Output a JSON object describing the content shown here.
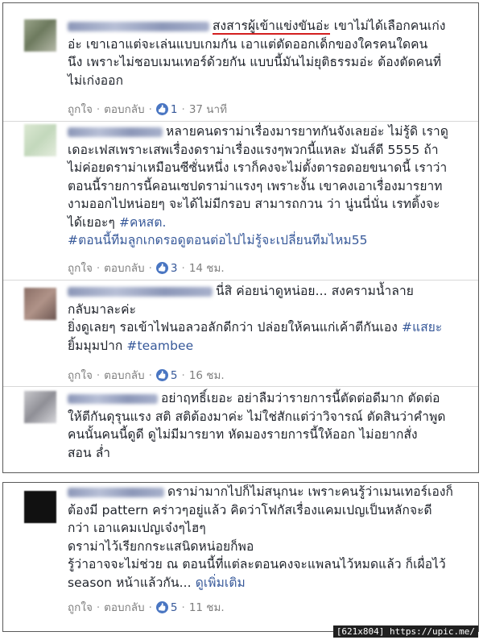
{
  "comments": [
    {
      "lines": [
        "",
        "อ่ะ เขาเอาแต่จะเล่นแบบเกมกัน เอาแต่ตัดออกเด็กของใครคนใดคน",
        "นึง เพราะไม่ชอบเมนเทอร์ด้วยกัน แบบนี้มันไม่ยุติธรรมอ่ะ ต้องตัดคนที่",
        "ไม่เก่งออก"
      ],
      "first_line_highlight": "สงสารผู้เข้าแข่งขันอ่ะ",
      "first_line_rest": " เขาไม่ได้เลือกคนเก่ง",
      "like_label": "ถูกใจ",
      "reply_label": "ตอบกลับ",
      "likes": "1",
      "time": "37 นาที"
    },
    {
      "lines": [
        "หลายคนดราม่าเรื่องมารยาทกันจังเลยอ่ะ ไม่รู้ดิ เราดู",
        "เดอะเฟสเพราะเสพเรื่องดราม่าเรื่องแรงๆพวกนี้แหละ มันส์ดี 5555 ถ้า",
        "ไม่ค่อยดราม่าเหมือนซีซั่นหนึ่ง เราก็คงจะไม่ตั้งตารอดอยขนาดนี้ เราว่า",
        "ตอนนี้รายการนี้คอนเซปดราม่าแรงๆ เพราะงั้น เขาคงเอาเรื่องมารยาท",
        "งามออกไปหน่อยๆ จะได้ไม่มีกรอบ สามารถกวน ว่า นู่นนี่นั่น เรทติ้งจะ",
        "ได้เยอะๆ"
      ],
      "hashtag_inline": "#คหสต.",
      "hashtag_line": "#ตอนนี้ทีมลูกเกดรอดูตอนต่อไปไม่รู้จะเปลี่ยนทีมไหม55",
      "like_label": "ถูกใจ",
      "reply_label": "ตอบกลับ",
      "likes": "3",
      "time": "14 ชม."
    },
    {
      "lines": [
        "นี่สิ ค่อยน่าดูหน่อย... สงครามน้ำลาย",
        "กลับมาละค่ะ",
        "ยิ่งดูเลยๆ รอเข้าไฟนอลวอลักดีกว่า ปล่อยให้คนแก่เค้าตีกันเอง",
        "ยิ้มมุมปาก"
      ],
      "hashtag_a": "#แสยะ",
      "hashtag_b": "#teambee",
      "like_label": "ถูกใจ",
      "reply_label": "ตอบกลับ",
      "likes": "5",
      "time": "16 ชม."
    },
    {
      "lines": [
        "อย่าฤทธิ์เยอะ อย่าลืมว่ารายการนี้ตัดต่อดีมาก ตัดต่อ",
        "ให้ตีกันดุรุนแรง สติ สติต้องมาค่ะ ไม่ใช่สักแต่ว่าวิจารณ์ ตัดสินว่าคำพูด",
        "คนนั้นคนนี้ดูดี ดูไม่มีมารยาท หัดมองรายการนี้ให้ออก ไม่อยากสั่ง",
        "สอน ล่ำ"
      ]
    },
    {
      "lines": [
        "ดราม่ามากไปก็ไม่สนุกนะ เพราะคนรู้ว่าเมนเทอร์เองก็",
        "ต้องมี pattern คร่าวๆอยู่แล้ว คิดว่าโฟกัสเรื่องแคมเปญเป็นหลักจะดี",
        "กว่า เอาแคมเปญเจ๋งๆไฮๆ",
        "ดราม่าไว้เรียกกระแสนิดหน่อยก็พอ",
        "รู้ว่าอาจจะไม่ช่วย ณ ตอนนี้ที่แต่ละตอนคงจะแพลนไว้หมดแล้ว ก็เผื่อไว้",
        "season หน้าแล้วกัน..."
      ],
      "see_more": "ดูเพิ่มเติม",
      "like_label": "ถูกใจ",
      "reply_label": "ตอบกลับ",
      "likes": "5",
      "time": "11 ชม."
    }
  ],
  "watermark": "[621x804] https://upic.me/",
  "colors": {
    "link": "#365899",
    "like_bubble": "#4a76c2",
    "underline": "#d32020",
    "meta": "#7f7f7f"
  }
}
